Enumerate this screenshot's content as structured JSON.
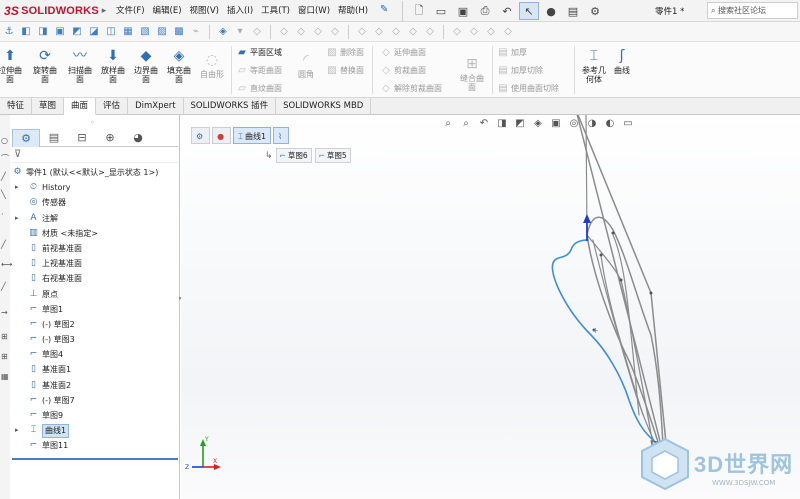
{
  "app": {
    "logo_text": "SOLIDWORKS",
    "logo_prefix": "3S",
    "document_name": "零件1 *",
    "search_placeholder": "搜索社区论坛"
  },
  "menu": [
    "文件(F)",
    "编辑(E)",
    "视图(V)",
    "插入(I)",
    "工具(T)",
    "窗口(W)",
    "帮助(H)"
  ],
  "quick_icons": [
    "new-icon",
    "open-icon",
    "save-icon",
    "print-icon",
    "undo-icon",
    "select-icon",
    "rebuild-icon",
    "file-properties-icon",
    "options-icon"
  ],
  "ribbon": {
    "big_buttons": [
      {
        "label": "拉伸曲\n面",
        "icon": "extrude-surface-icon",
        "enabled": true
      },
      {
        "label": "旋转曲\n面",
        "icon": "revolve-surface-icon",
        "enabled": true
      },
      {
        "label": "扫描曲\n面",
        "icon": "sweep-surface-icon",
        "enabled": true
      },
      {
        "label": "放样曲\n面",
        "icon": "loft-surface-icon",
        "enabled": true
      },
      {
        "label": "边界曲\n面",
        "icon": "boundary-surface-icon",
        "enabled": true
      },
      {
        "label": "填充曲\n面",
        "icon": "fill-surface-icon",
        "enabled": true
      },
      {
        "label": "自由形",
        "icon": "freeform-icon",
        "enabled": false
      }
    ],
    "small_col1": [
      {
        "label": "平面区域",
        "enabled": true
      },
      {
        "label": "等距曲面",
        "enabled": false
      },
      {
        "label": "直纹曲面",
        "enabled": false
      }
    ],
    "fillet_label": "圆角",
    "small_col2": [
      {
        "label": "删除面",
        "enabled": false
      },
      {
        "label": "替换面",
        "enabled": false
      }
    ],
    "small_col3": [
      {
        "label": "延伸曲面",
        "enabled": false
      },
      {
        "label": "剪裁曲面",
        "enabled": false
      },
      {
        "label": "解除剪裁曲面",
        "enabled": false
      }
    ],
    "knit_label": "缝合曲\n面",
    "small_col4": [
      {
        "label": "加厚",
        "enabled": false
      },
      {
        "label": "加厚切除",
        "enabled": false
      },
      {
        "label": "使用曲面切除",
        "enabled": false
      }
    ],
    "ref_geometry_label": "参考几\n何体",
    "curves_label": "曲线"
  },
  "tabs": [
    {
      "label": "特征",
      "active": false
    },
    {
      "label": "草图",
      "active": false
    },
    {
      "label": "曲面",
      "active": true
    },
    {
      "label": "评估",
      "active": false
    },
    {
      "label": "DimXpert",
      "active": false
    },
    {
      "label": "SOLIDWORKS 插件",
      "active": false
    },
    {
      "label": "SOLIDWORKS MBD",
      "active": false
    }
  ],
  "feature_tree": {
    "root": "零件1 (默认<<默认>_显示状态 1>)",
    "items": [
      {
        "label": "History",
        "icon": "history-icon",
        "expandable": true
      },
      {
        "label": "传感器",
        "icon": "sensor-icon",
        "expandable": false
      },
      {
        "label": "注解",
        "icon": "annotation-icon",
        "expandable": true
      },
      {
        "label": "材质 <未指定>",
        "icon": "material-icon",
        "expandable": false
      },
      {
        "label": "前视基准面",
        "icon": "plane-icon",
        "expandable": false
      },
      {
        "label": "上视基准面",
        "icon": "plane-icon",
        "expandable": false
      },
      {
        "label": "右视基准面",
        "icon": "plane-icon",
        "expandable": false
      },
      {
        "label": "原点",
        "icon": "origin-icon",
        "expandable": false
      },
      {
        "label": "草图1",
        "icon": "sketch-icon",
        "expandable": false
      },
      {
        "label": "(-) 草图2",
        "icon": "sketch-icon",
        "expandable": false
      },
      {
        "label": "(-) 草图3",
        "icon": "sketch-icon",
        "expandable": false
      },
      {
        "label": "草图4",
        "icon": "sketch-icon",
        "expandable": false
      },
      {
        "label": "基准面1",
        "icon": "plane-icon",
        "expandable": false
      },
      {
        "label": "基准面2",
        "icon": "plane-icon",
        "expandable": false
      },
      {
        "label": "(-) 草图7",
        "icon": "sketch-icon",
        "expandable": false
      },
      {
        "label": "草图9",
        "icon": "sketch-icon",
        "expandable": false
      },
      {
        "label": "曲线1",
        "icon": "curve-icon",
        "expandable": true,
        "selected": true
      },
      {
        "label": "草图11",
        "icon": "sketch-icon",
        "expandable": false
      }
    ]
  },
  "breadcrumb": {
    "main": "曲线1",
    "sub": [
      "草图6",
      "草图5"
    ]
  },
  "triad": {
    "x": "X",
    "y": "Y",
    "z": "Z"
  },
  "watermark": {
    "title": "3D世界网",
    "url": "WWW.3DSJW.COM"
  },
  "colors": {
    "accent": "#2f6fb5",
    "curve": "#3a8fd9",
    "sketch": "#8c8c8c",
    "brand": "#c8102e"
  }
}
